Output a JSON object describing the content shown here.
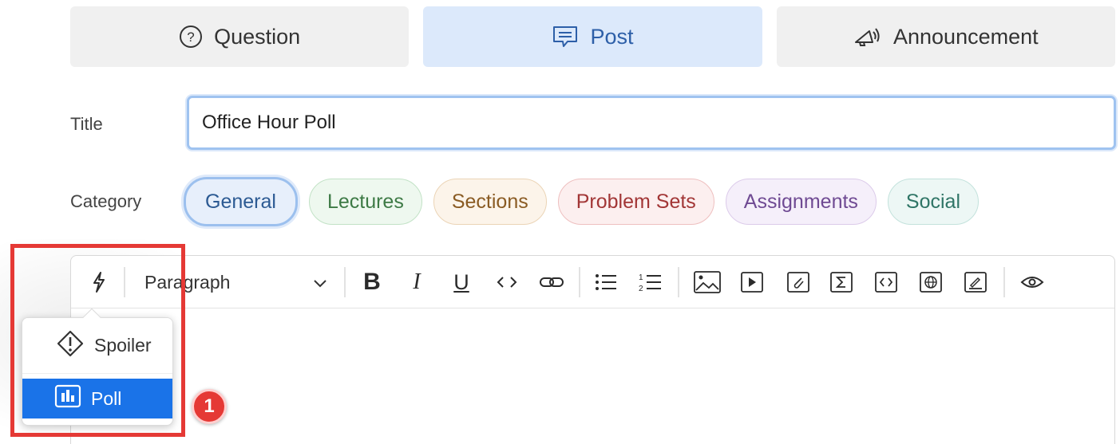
{
  "post_types": [
    {
      "label": "Question",
      "icon": "question-circle-icon"
    },
    {
      "label": "Post",
      "icon": "speech-bubble-icon"
    },
    {
      "label": "Announcement",
      "icon": "megaphone-icon"
    }
  ],
  "active_post_type": "Post",
  "title_field": {
    "label": "Title",
    "value": "Office Hour Poll"
  },
  "category": {
    "label": "Category",
    "selected": "General",
    "options": [
      "General",
      "Lectures",
      "Sections",
      "Problem Sets",
      "Assignments",
      "Social"
    ]
  },
  "toolbar": {
    "block_style": "Paragraph",
    "buttons": [
      "insert-icon",
      "bold-icon",
      "italic-icon",
      "underline-icon",
      "inline-code-icon",
      "link-icon",
      "bullet-list-icon",
      "numbered-list-icon",
      "image-icon",
      "video-icon",
      "attachment-icon",
      "math-icon",
      "code-block-icon",
      "embed-web-icon",
      "drawing-icon",
      "preview-icon"
    ]
  },
  "insert_menu": {
    "items": [
      {
        "label": "Spoiler",
        "icon": "warning-diamond-icon"
      },
      {
        "label": "Poll",
        "icon": "bar-chart-icon",
        "highlighted": true
      }
    ]
  },
  "annotation": {
    "step": "1",
    "color": "#e53935"
  },
  "colors": {
    "accent": "#1a73e8",
    "active_tab_bg": "#dce9fb",
    "focus_ring": "#9fc3f0"
  }
}
